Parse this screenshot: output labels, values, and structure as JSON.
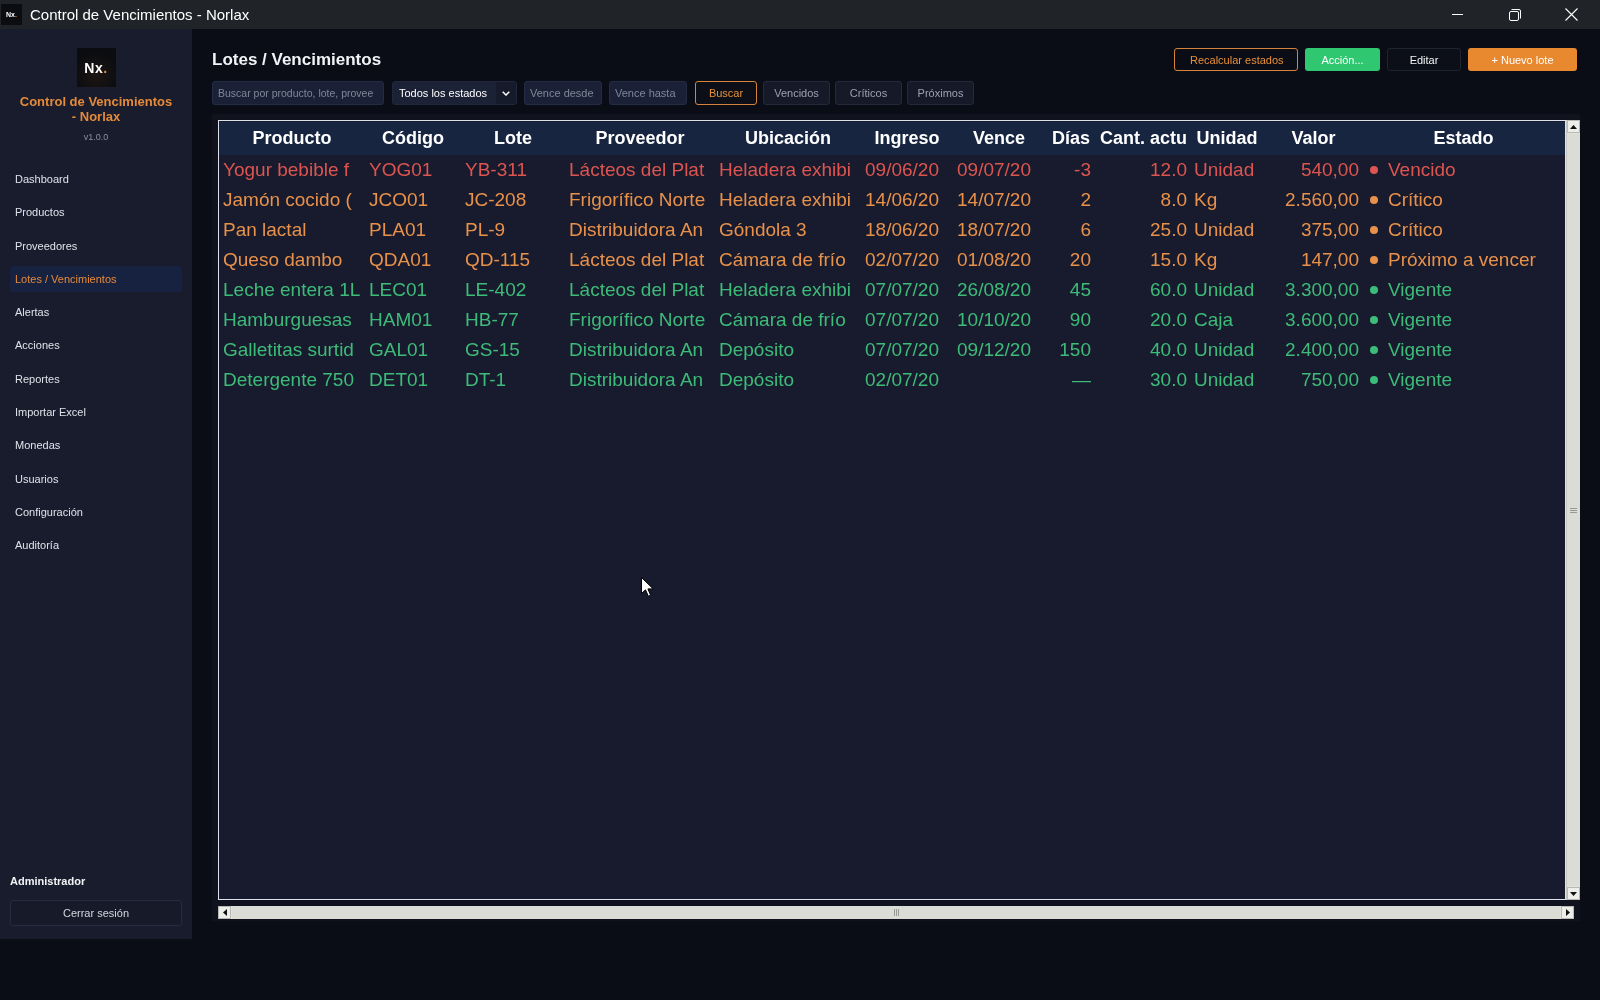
{
  "window": {
    "icon": {
      "letters": "Nx",
      "accent": "."
    },
    "title": "Control de Vencimientos - Norlax"
  },
  "sidebar": {
    "logo": {
      "letters": "Nx",
      "accent": "."
    },
    "app_name": "Control de Vencimientos - Norlax",
    "version": "v1.0.0",
    "items": [
      {
        "label": "Dashboard",
        "selected": false
      },
      {
        "label": "Productos",
        "selected": false
      },
      {
        "label": "Proveedores",
        "selected": false
      },
      {
        "label": "Lotes / Vencimientos",
        "selected": true
      },
      {
        "label": "Alertas",
        "selected": false
      },
      {
        "label": "Acciones",
        "selected": false
      },
      {
        "label": "Reportes",
        "selected": false
      },
      {
        "label": "Importar Excel",
        "selected": false
      },
      {
        "label": "Monedas",
        "selected": false
      },
      {
        "label": "Usuarios",
        "selected": false
      },
      {
        "label": "Configuración",
        "selected": false
      },
      {
        "label": "Auditoría",
        "selected": false
      }
    ],
    "user": "Administrador",
    "logout_button": "Cerrar sesión"
  },
  "main": {
    "title": "Lotes / Vencimientos",
    "actions": [
      {
        "label": "Recalcular estados",
        "kind": "outline"
      },
      {
        "label": "Acción...",
        "kind": "success"
      },
      {
        "label": "Editar",
        "kind": "plain"
      },
      {
        "label": "+ Nuevo lote",
        "kind": "primary"
      }
    ],
    "filters": {
      "search": {
        "placeholder": "Buscar por producto, lote, provee"
      },
      "status_select": {
        "value": "Todos los estados"
      },
      "date_from": {
        "placeholder": "Vence desde"
      },
      "date_to": {
        "placeholder": "Vence hasta"
      },
      "search_button": "Buscar",
      "quick_filters": [
        "Vencidos",
        "Críticos",
        "Próximos"
      ]
    },
    "table": {
      "columns": [
        "Producto",
        "Código",
        "Lote",
        "Proveedor",
        "Ubicación",
        "Ingreso",
        "Vence",
        "Días",
        "Cant. actu",
        "Unidad",
        "Valor",
        "Estado"
      ],
      "rows": [
        {
          "product": "Yogur bebible f",
          "code": "YOG01",
          "lot": "YB-311",
          "supplier": "Lácteos del Plat",
          "location": "Heladera exhibi",
          "received": "09/06/20",
          "expires": "09/07/20",
          "days": "-3",
          "quantity": "12.0",
          "unit": "Unidad",
          "value": "540,00",
          "status": "Vencido",
          "color": "#dc5550"
        },
        {
          "product": "Jamón cocido (",
          "code": "JCO01",
          "lot": "JC-208",
          "supplier": "Frigorífico Norte",
          "location": "Heladera exhibi",
          "received": "14/06/20",
          "expires": "14/07/20",
          "days": "2",
          "quantity": "8.0",
          "unit": "Kg",
          "value": "2.560,00",
          "status": "Crítico",
          "color": "#e8914a"
        },
        {
          "product": "Pan lactal",
          "code": "PLA01",
          "lot": "PL-9",
          "supplier": "Distribuidora An",
          "location": "Góndola 3",
          "received": "18/06/20",
          "expires": "18/07/20",
          "days": "6",
          "quantity": "25.0",
          "unit": "Unidad",
          "value": "375,00",
          "status": "Crítico",
          "color": "#e8914a"
        },
        {
          "product": "Queso dambo",
          "code": "QDA01",
          "lot": "QD-115",
          "supplier": "Lácteos del Plat",
          "location": "Cámara de frío",
          "received": "02/07/20",
          "expires": "01/08/20",
          "days": "20",
          "quantity": "15.0",
          "unit": "Kg",
          "value": "147,00",
          "status": "Próximo a vencer",
          "color": "#e8914a"
        },
        {
          "product": "Leche entera 1L",
          "code": "LEC01",
          "lot": "LE-402",
          "supplier": "Lácteos del Plat",
          "location": "Heladera exhibi",
          "received": "07/07/20",
          "expires": "26/08/20",
          "days": "45",
          "quantity": "60.0",
          "unit": "Unidad",
          "value": "3.300,00",
          "status": "Vigente",
          "color": "#3dbb78"
        },
        {
          "product": "Hamburguesas",
          "code": "HAM01",
          "lot": "HB-77",
          "supplier": "Frigorífico Norte",
          "location": "Cámara de frío",
          "received": "07/07/20",
          "expires": "10/10/20",
          "days": "90",
          "quantity": "20.0",
          "unit": "Caja",
          "value": "3.600,00",
          "status": "Vigente",
          "color": "#3dbb78"
        },
        {
          "product": "Galletitas surtid",
          "code": "GAL01",
          "lot": "GS-15",
          "supplier": "Distribuidora An",
          "location": "Depósito",
          "received": "07/07/20",
          "expires": "09/12/20",
          "days": "150",
          "quantity": "40.0",
          "unit": "Unidad",
          "value": "2.400,00",
          "status": "Vigente",
          "color": "#3dbb78"
        },
        {
          "product": "Detergente 750",
          "code": "DET01",
          "lot": "DT-1",
          "supplier": "Distribuidora An",
          "location": "Depósito",
          "received": "02/07/20",
          "days": "—",
          "quantity": "30.0",
          "unit": "Unidad",
          "value": "750,00",
          "status": "Vigente",
          "color": "#3dbb78"
        }
      ]
    }
  }
}
